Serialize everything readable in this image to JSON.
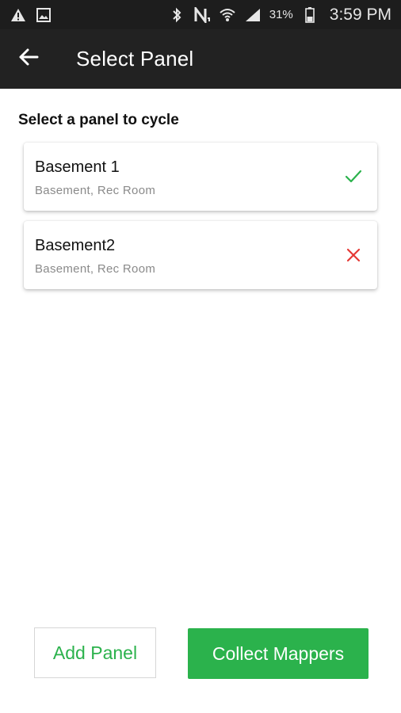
{
  "status_bar": {
    "battery_percent": "31%",
    "time": "3:59 PM",
    "icons": [
      "warning-icon",
      "image-icon",
      "bluetooth-icon",
      "nfc-icon",
      "wifi-icon",
      "signal-icon",
      "battery-icon"
    ]
  },
  "app_bar": {
    "title": "Select Panel",
    "back_icon": "arrow-left-icon"
  },
  "main": {
    "heading": "Select a panel to cycle",
    "panels": [
      {
        "name": "Basement 1",
        "location": "Basement, Rec Room",
        "status": "selected",
        "status_icon": "check-icon",
        "status_color": "#2bb24c"
      },
      {
        "name": "Basement2",
        "location": "Basement, Rec Room",
        "status": "not-selected",
        "status_icon": "close-icon",
        "status_color": "#e53935"
      }
    ]
  },
  "actions": {
    "add_panel_label": "Add Panel",
    "collect_mappers_label": "Collect Mappers"
  },
  "colors": {
    "accent": "#2bb24c",
    "error": "#e53935",
    "app_bar": "#222222",
    "status_bar": "#1d1d1d"
  }
}
